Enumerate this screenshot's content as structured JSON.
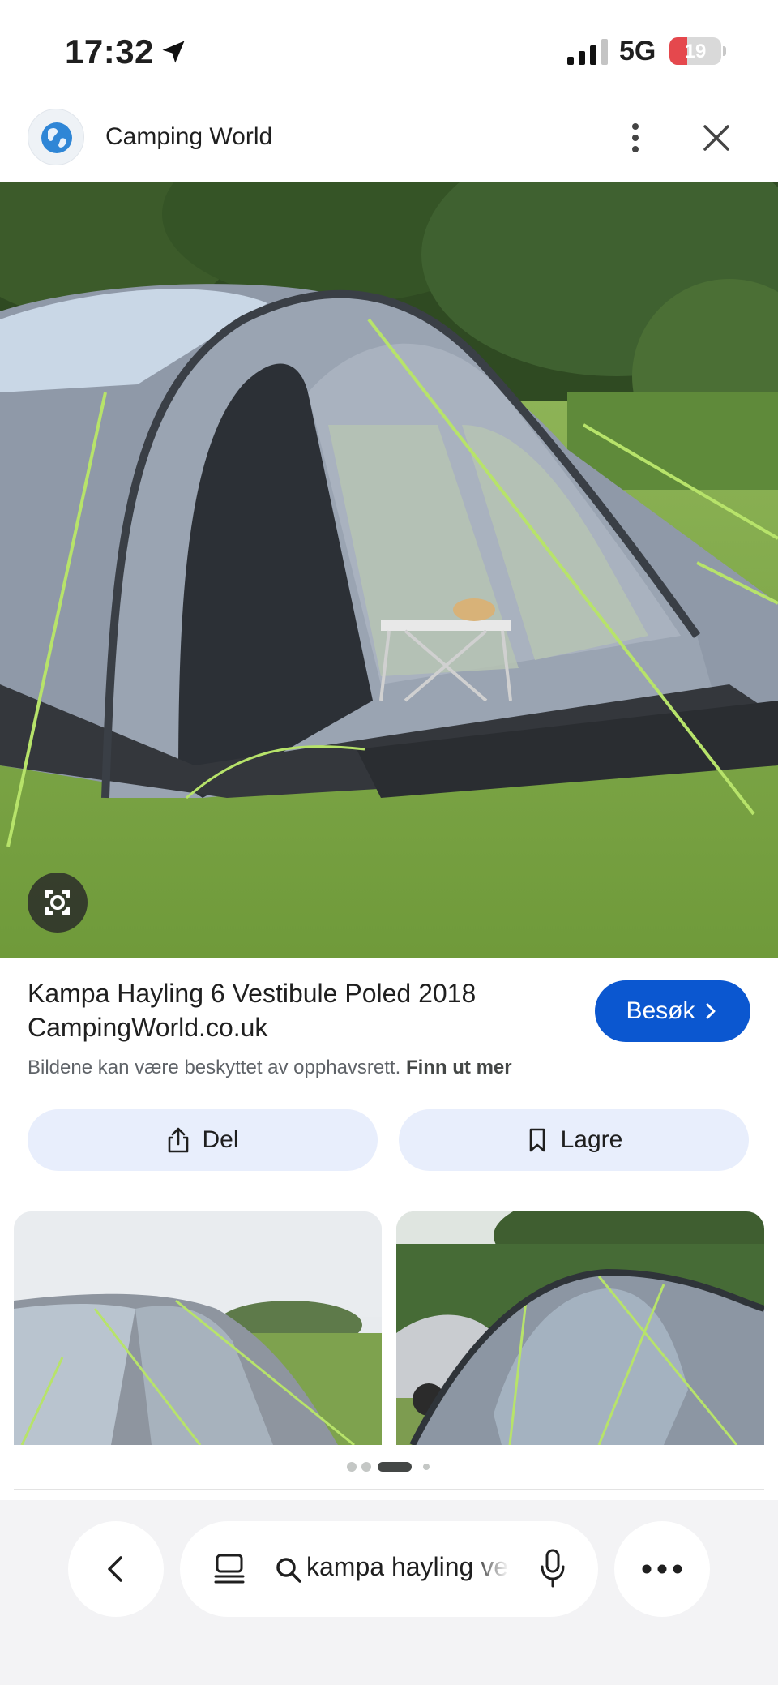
{
  "status_bar": {
    "time": "17:32",
    "network": "5G",
    "battery_level": "19",
    "battery_color": "#e5484d"
  },
  "source": {
    "site_name": "Camping World",
    "logo_icon": "globe-icon",
    "menu_icon": "more-vert-icon",
    "close_icon": "close-icon"
  },
  "result": {
    "title": "Kampa Hayling 6 Vestibule Poled 2018",
    "domain": "CampingWorld.co.uk",
    "copyright_text": "Bildene kan være beskyttet av opphavsrett.",
    "learn_more": "Finn ut mer",
    "visit_label": "Besøk",
    "accent_color": "#0b57d0"
  },
  "actions": {
    "share_label": "Del",
    "save_label": "Lagre",
    "share_icon": "share-icon",
    "save_icon": "bookmark-icon"
  },
  "related": {
    "carousel_dot_count": 4,
    "active_dot_index": 2
  },
  "bottom_bar": {
    "query": "kampa hayling vestibule",
    "back_icon": "chevron-left-icon",
    "tabs_icon": "tabs-icon",
    "search_icon": "search-icon",
    "mic_icon": "mic-icon",
    "more_icon": "more-horiz-icon"
  }
}
